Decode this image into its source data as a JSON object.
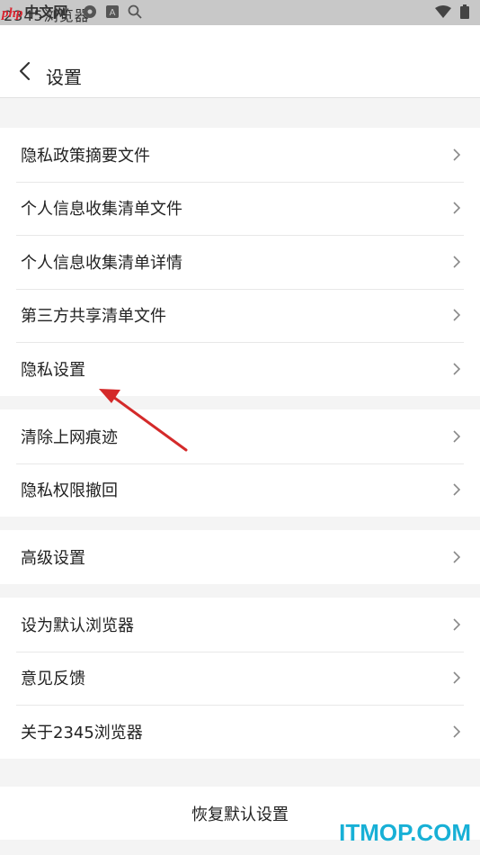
{
  "status_bar": {
    "app_title": "2345浏览器"
  },
  "watermark_logo": {
    "php": "php",
    "cn": "中文网"
  },
  "header": {
    "title": "设置"
  },
  "sections": [
    [
      "隐私政策摘要文件",
      "个人信息收集清单文件",
      "个人信息收集清单详情",
      "第三方共享清单文件",
      "隐私设置"
    ],
    [
      "清除上网痕迹",
      "隐私权限撤回"
    ],
    [
      "高级设置"
    ],
    [
      "设为默认浏览器",
      "意见反馈",
      "关于2345浏览器"
    ]
  ],
  "reset": {
    "label": "恢复默认设置"
  },
  "watermark_site": "ITMOP.COM",
  "colors": {
    "annotation_arrow": "#d42a2a",
    "watermark_site": "#18b0d6",
    "watermark_php": "#d9232e"
  }
}
